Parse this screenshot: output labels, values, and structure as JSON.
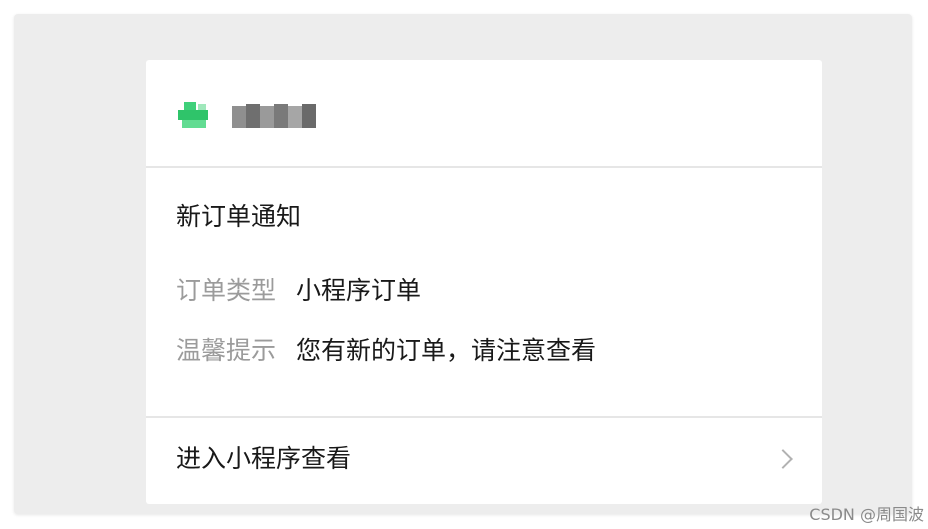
{
  "card": {
    "title": "新订单通知",
    "fields": [
      {
        "label": "订单类型",
        "value": "小程序订单"
      },
      {
        "label": "温馨提示",
        "value": "您有新的订单，请注意查看"
      }
    ],
    "footer_link": "进入小程序查看"
  },
  "watermark": "CSDN @周国波",
  "colors": {
    "frame_bg": "#ededed",
    "card_bg": "#ffffff",
    "text_primary": "#191919",
    "text_secondary": "#9b9b9b",
    "logo_green": "#3fd07a",
    "divider": "#e6e6e6"
  },
  "icons": {
    "logo": "mini-program-logo-icon",
    "chevron": "chevron-right-icon"
  }
}
